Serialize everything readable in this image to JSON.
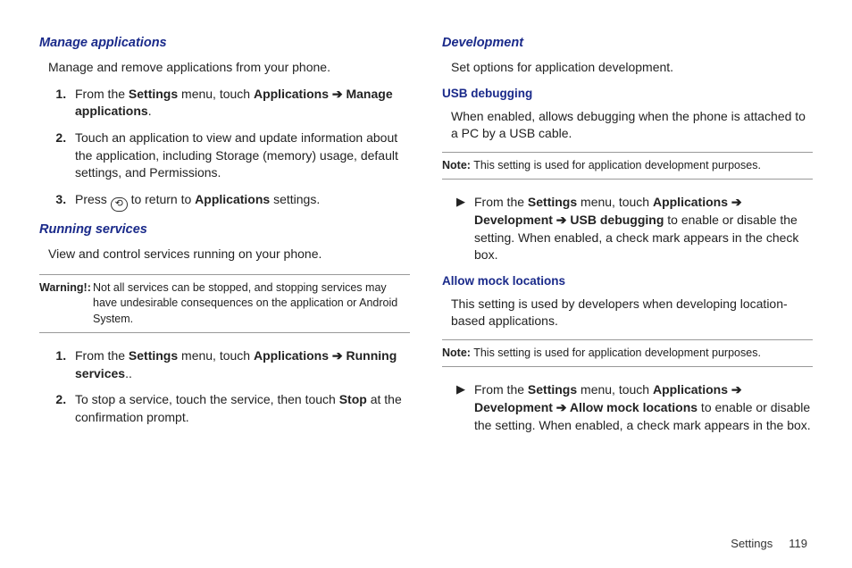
{
  "left": {
    "h1": "Manage applications",
    "intro": "Manage and remove applications from your phone.",
    "steps1": {
      "s1_a": "From the ",
      "s1_b": "Settings",
      "s1_c": " menu, touch ",
      "s1_d": "Applications ➔ Manage applications",
      "s1_e": ".",
      "s2": "Touch an application to view and update information about the application, including Storage (memory) usage, default settings, and Permissions.",
      "s3_a": "Press ",
      "s3_b": " to return to ",
      "s3_c": "Applications",
      "s3_d": " settings."
    },
    "h2": "Running services",
    "intro2": "View and control services running on your phone.",
    "warn_label": "Warning!:",
    "warn_text": "Not all services can be stopped, and stopping services may have undesirable consequences on the application or Android System.",
    "steps2": {
      "s1_a": "From the ",
      "s1_b": "Settings",
      "s1_c": " menu, touch ",
      "s1_d": "Applications ➔ Running services",
      "s1_e": "..",
      "s2_a": "To stop a service, touch the service, then touch ",
      "s2_b": "Stop",
      "s2_c": " at the confirmation prompt."
    }
  },
  "right": {
    "h1": "Development",
    "intro": "Set options for application development.",
    "sub1": "USB debugging",
    "p1": "When enabled, allows debugging when the phone is attached to a PC by a USB cable.",
    "note1_label": "Note:",
    "note1_text": " This setting is used for application development purposes.",
    "bullet1": {
      "a": "From the ",
      "b": "Settings",
      "c": " menu, touch ",
      "d": "Applications ➔ Development ➔ USB debugging ",
      "e": " to enable or disable the setting. When enabled, a check mark appears in the check box."
    },
    "sub2": "Allow mock locations",
    "p2": "This setting is used by developers when developing location-based applications.",
    "note2_label": "Note:",
    "note2_text": " This setting is used for application development purposes.",
    "bullet2": {
      "a": "From the ",
      "b": "Settings",
      "c": " menu, touch ",
      "d": "Applications ➔ Development ➔ Allow mock locations",
      "e": " to enable or disable the setting. When enabled, a check mark appears in the box."
    }
  },
  "footer": {
    "section": "Settings",
    "page": "119"
  },
  "glyphs": {
    "play": "▶",
    "return": "⟲"
  }
}
